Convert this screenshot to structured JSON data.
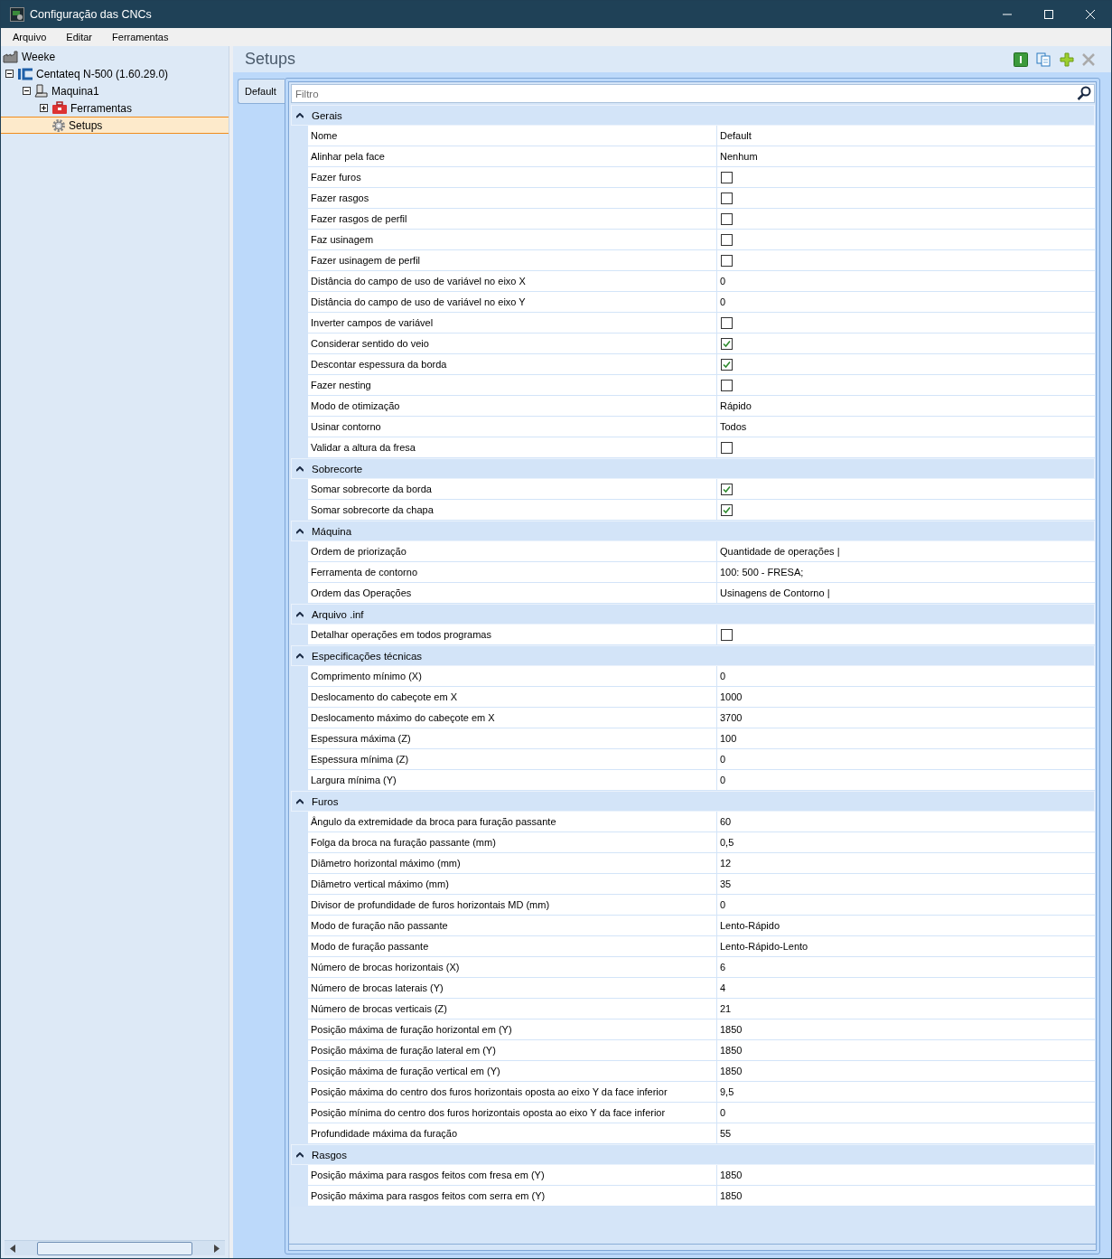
{
  "window": {
    "title": "Configuração das CNCs"
  },
  "menu": [
    "Arquivo",
    "Editar",
    "Ferramentas"
  ],
  "tree": [
    {
      "label": "Weeke",
      "selected": false
    },
    {
      "label": "Centateq N-500 (1.60.29.0)",
      "expanded": true,
      "selected": false,
      "children": [
        {
          "label": "Maquina1",
          "expanded": true,
          "selected": false,
          "children": [
            {
              "label": "Ferramentas",
              "expanded": false,
              "selected": false
            },
            {
              "label": "Setups",
              "selected": true
            }
          ]
        }
      ]
    }
  ],
  "panel": {
    "title": "Setups"
  },
  "tabs": [
    {
      "label": "Default",
      "selected": true
    }
  ],
  "filter": {
    "placeholder": "Filtro"
  },
  "groups": [
    {
      "title": "Gerais",
      "expanded": true,
      "rows": [
        {
          "label": "Nome",
          "kind": "text",
          "value": "Default"
        },
        {
          "label": "Alinhar pela face",
          "kind": "text",
          "value": "Nenhum"
        },
        {
          "label": "Fazer furos",
          "kind": "check",
          "checked": false
        },
        {
          "label": "Fazer rasgos",
          "kind": "check",
          "checked": false
        },
        {
          "label": "Fazer rasgos de perfil",
          "kind": "check",
          "checked": false
        },
        {
          "label": "Faz usinagem",
          "kind": "check",
          "checked": false
        },
        {
          "label": "Fazer usinagem de perfil",
          "kind": "check",
          "checked": false
        },
        {
          "label": "Distância do campo de uso de variável no eixo X",
          "kind": "text",
          "value": "0"
        },
        {
          "label": "Distância do campo de uso de variável no eixo Y",
          "kind": "text",
          "value": "0"
        },
        {
          "label": "Inverter campos de variável",
          "kind": "check",
          "checked": false
        },
        {
          "label": "Considerar sentido do veio",
          "kind": "check",
          "checked": true
        },
        {
          "label": "Descontar espessura da borda",
          "kind": "check",
          "checked": true
        },
        {
          "label": "Fazer nesting",
          "kind": "check",
          "checked": false
        },
        {
          "label": "Modo de otimização",
          "kind": "text",
          "value": "Rápido"
        },
        {
          "label": "Usinar contorno",
          "kind": "text",
          "value": "Todos"
        },
        {
          "label": "Validar a altura da fresa",
          "kind": "check",
          "checked": false
        }
      ]
    },
    {
      "title": "Sobrecorte",
      "expanded": true,
      "rows": [
        {
          "label": "Somar sobrecorte da borda",
          "kind": "check",
          "checked": true
        },
        {
          "label": "Somar sobrecorte da chapa",
          "kind": "check",
          "checked": true
        }
      ]
    },
    {
      "title": "Máquina",
      "expanded": true,
      "rows": [
        {
          "label": "Ordem de priorização",
          "kind": "text",
          "value": "Quantidade de operações |"
        },
        {
          "label": "Ferramenta de contorno",
          "kind": "text",
          "value": "100: 500 - FRESA;"
        },
        {
          "label": "Ordem das Operações",
          "kind": "text",
          "value": "Usinagens de Contorno |"
        }
      ]
    },
    {
      "title": "Arquivo .inf",
      "expanded": true,
      "rows": [
        {
          "label": "Detalhar operações em todos programas",
          "kind": "check",
          "checked": false
        }
      ]
    },
    {
      "title": "Especificações técnicas",
      "expanded": true,
      "rows": [
        {
          "label": "Comprimento mínimo (X)",
          "kind": "text",
          "value": "0"
        },
        {
          "label": "Deslocamento do cabeçote em X",
          "kind": "text",
          "value": "1000"
        },
        {
          "label": "Deslocamento máximo do cabeçote em X",
          "kind": "text",
          "value": "3700"
        },
        {
          "label": "Espessura máxima (Z)",
          "kind": "text",
          "value": "100"
        },
        {
          "label": "Espessura mínima (Z)",
          "kind": "text",
          "value": "0"
        },
        {
          "label": "Largura mínima (Y)",
          "kind": "text",
          "value": "0"
        }
      ]
    },
    {
      "title": "Furos",
      "expanded": true,
      "rows": [
        {
          "label": "Ângulo da extremidade da broca para furação passante",
          "kind": "text",
          "value": "60"
        },
        {
          "label": "Folga da broca na furação passante (mm)",
          "kind": "text",
          "value": "0,5"
        },
        {
          "label": "Diâmetro horizontal máximo (mm)",
          "kind": "text",
          "value": "12"
        },
        {
          "label": "Diâmetro vertical máximo (mm)",
          "kind": "text",
          "value": "35"
        },
        {
          "label": "Divisor de profundidade de furos horizontais MD (mm)",
          "kind": "text",
          "value": "0"
        },
        {
          "label": "Modo de furação não passante",
          "kind": "text",
          "value": "Lento-Rápido"
        },
        {
          "label": "Modo de furação passante",
          "kind": "text",
          "value": "Lento-Rápido-Lento"
        },
        {
          "label": "Número de brocas horizontais (X)",
          "kind": "text",
          "value": "6"
        },
        {
          "label": "Número de brocas laterais (Y)",
          "kind": "text",
          "value": "4"
        },
        {
          "label": "Número de brocas verticais (Z)",
          "kind": "text",
          "value": "21"
        },
        {
          "label": "Posição máxima de furação horizontal em (Y)",
          "kind": "text",
          "value": "1850"
        },
        {
          "label": "Posição máxima de furação lateral em (Y)",
          "kind": "text",
          "value": "1850"
        },
        {
          "label": "Posição máxima de furação vertical em (Y)",
          "kind": "text",
          "value": "1850"
        },
        {
          "label": "Posição máxima do centro dos furos horizontais oposta ao eixo Y da face inferior",
          "kind": "text",
          "value": "9,5"
        },
        {
          "label": "Posição mínima do centro dos furos horizontais oposta ao eixo Y da face inferior",
          "kind": "text",
          "value": "0"
        },
        {
          "label": "Profundidade máxima da furação",
          "kind": "text",
          "value": "55"
        }
      ]
    },
    {
      "title": "Rasgos",
      "expanded": true,
      "rows": [
        {
          "label": "Posição máxima para rasgos feitos com fresa em (Y)",
          "kind": "text",
          "value": "1850"
        },
        {
          "label": "Posição máxima para rasgos feitos com serra em (Y)",
          "kind": "text",
          "value": "1850"
        }
      ]
    }
  ]
}
